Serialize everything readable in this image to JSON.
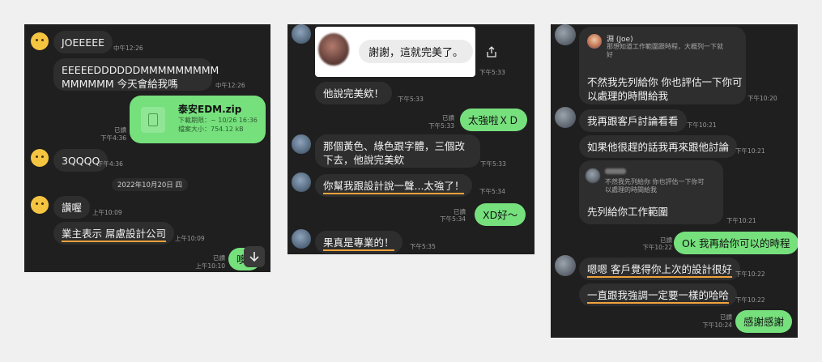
{
  "p1": {
    "m1": {
      "text": "JOEEEEE",
      "time": "中午12:26"
    },
    "m2": {
      "line1": "EEEEEDDDDDDMMMMMMMMM",
      "line2": "MMMMMM 今天會給我嗎",
      "time": "中午12:26"
    },
    "file": {
      "name": "泰安EDM.zip",
      "deadline": "下載期限：~ 10/26 16:36",
      "size": "檔案大小：754.12 kB",
      "read": "已讀",
      "time": "下午4:36"
    },
    "m3": {
      "text": "3QQQQ",
      "time": "下午4:36"
    },
    "date": "2022年10月20日 四",
    "m4": {
      "text": "讚喔",
      "time": "上午10:09"
    },
    "m5": {
      "text": "業主表示  屌慮設計公司",
      "time": "上午10:09"
    },
    "m6": {
      "text": "噢",
      "read": "已讀",
      "time": "上午10:10"
    }
  },
  "p2": {
    "quote": {
      "text": "謝謝，這就完美了。",
      "time": "下午5:33"
    },
    "m1": {
      "text": "他說完美欸！",
      "time": "下午5:33"
    },
    "m2": {
      "text": "太強啦ＸＤ",
      "read": "已讀",
      "time": "下午5:33"
    },
    "m3": {
      "line1": "那個黃色、綠色跟字體，三個改",
      "line2": "下去，他說完美欸",
      "time": "下午5:33"
    },
    "m4": {
      "text": "你幫我跟設計說一聲...太強了！",
      "time": "下午5:34"
    },
    "m5": {
      "text": "XD好～",
      "read": "已讀",
      "time": "下午5:34"
    },
    "m6": {
      "text": "果真是專業的！",
      "time": "下午5:35"
    }
  },
  "p3": {
    "m1": {
      "reply_name": "淵 (Joe)",
      "reply_line1": "那想知道工作範圍跟時程，大概列一下就",
      "reply_line2": "好",
      "line1": "不然我先列給你 你也評估一下你可",
      "line2": "以處理的時間給我",
      "time": "下午10:20"
    },
    "m2": {
      "text": "我再跟客戶討論看看",
      "time": "下午10:21"
    },
    "m3": {
      "text": "如果他很趕的話我再來跟他討論",
      "time": "下午10:21"
    },
    "m4": {
      "reply_line1": "不然我先列給你 你也評估一下你可",
      "reply_line2": "以處理的時間給我",
      "text": "先列給你工作範圍",
      "time": "下午10:21"
    },
    "m5": {
      "text": "Ok 我再給你可以的時程",
      "read": "已讀",
      "time": "下午10:22"
    },
    "m6": {
      "text": "嗯嗯 客戶覺得你上次的設計很好",
      "time": "下午10:22"
    },
    "m7": {
      "text": "一直跟我強調一定要一樣的哈哈",
      "time": "下午10:22"
    },
    "m8": {
      "text": "感謝感謝",
      "read": "已讀",
      "time": "下午10:24"
    }
  },
  "colors": {
    "panel_bg": "#1f1f1f",
    "bubble_in": "#2e2e2e",
    "bubble_out": "#76e07d",
    "underline": "#f0a23c"
  },
  "icons": [
    "share-icon",
    "scroll-down-arrow-icon",
    "file-icon"
  ]
}
